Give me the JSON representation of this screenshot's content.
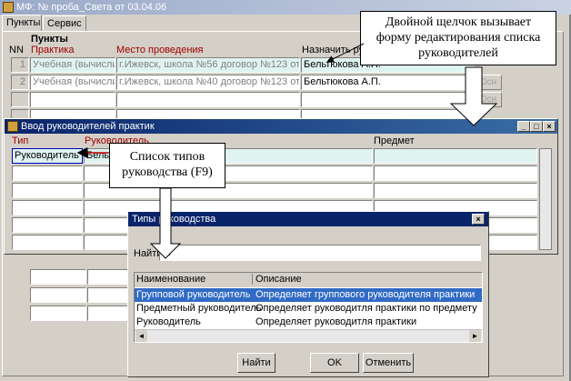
{
  "main_window": {
    "title": "МФ: № проба_Света от 03.04.06",
    "tabs": [
      "Пункты",
      "Сервис"
    ],
    "section_title": "Пункты",
    "col_nn": "NN",
    "col_practice": "Практика",
    "col_place": "Место проведения",
    "col_assign": "Назначить руково",
    "rows": [
      {
        "nn": "1",
        "practice": "Учебная (вычислит",
        "place": "г.Ижевск, школа №56 договор №123 от:",
        "leader": "Бельтюкова А.П.",
        "btn": "Осн"
      },
      {
        "nn": "2",
        "practice": "Учебная (вычислит",
        "place": "г.Ижевск, школа №40 договор №123 от:",
        "leader": "Бельтюкова А.П.",
        "btn": "Осн"
      },
      {
        "nn": "",
        "practice": "",
        "place": "",
        "leader": "",
        "btn": "Осн"
      }
    ]
  },
  "leaders_form": {
    "title": "Ввод руководителей практик",
    "col_type": "Тип",
    "col_leader": "Руководитель",
    "col_subject": "Предмет",
    "row1_type": "Руководитель",
    "row1_leader": "Бель"
  },
  "types_dialog": {
    "title": "Типы руководства",
    "find_label": "Найти",
    "find_value": "%",
    "col_name": "Наименование",
    "col_desc": "Описание",
    "rows": [
      {
        "name": "Групповой руководитель",
        "desc": "Определяет группового руководителя практики",
        "selected": true
      },
      {
        "name": "Предметный руководитель",
        "desc": "Определяет руководитля практики по предмету",
        "selected": false
      },
      {
        "name": "Руководитель",
        "desc": "Определяет руководитля практики",
        "selected": false
      }
    ],
    "btn_find": "Найти",
    "btn_ok": "OK",
    "btn_cancel": "Отменить"
  },
  "callouts": {
    "top_right": "Двойной щелчок вызывает форму редактирования списка руководителей",
    "middle": "Список типов руководства (F9)"
  },
  "icons": {
    "minimize": "_",
    "maximize": "□",
    "close": "×",
    "scroll_left": "◄",
    "scroll_right": "►"
  }
}
